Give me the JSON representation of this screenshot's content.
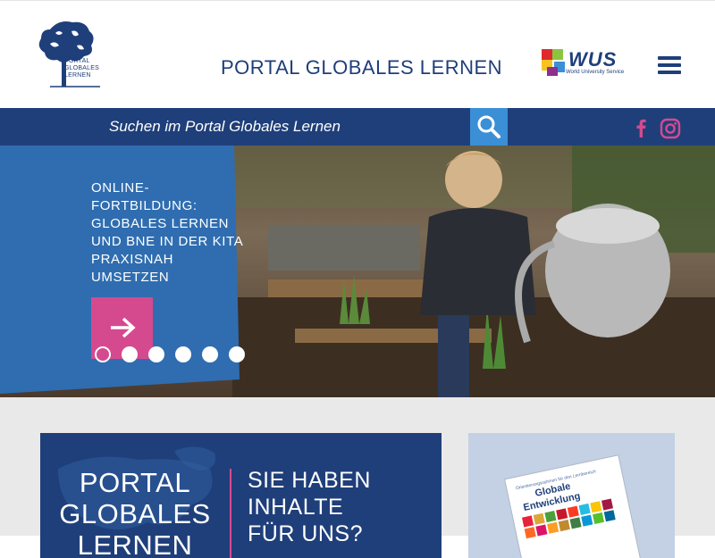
{
  "header": {
    "logo_line1": "PORTAL",
    "logo_line2": "GLOBALES",
    "logo_line3": "LERNEN",
    "site_title": "PORTAL GLOBALES LERNEN",
    "partner_name": "WUS",
    "partner_sub": "World University Service",
    "menu_icon": "hamburger-icon"
  },
  "search": {
    "placeholder": "Suchen im Portal Globales Lernen",
    "button_icon": "search-icon"
  },
  "social": {
    "facebook_icon": "facebook-icon",
    "instagram_icon": "instagram-icon"
  },
  "hero": {
    "title": "Online-Fortbildung: Globales Lernen und BNE in der Kita praxisnah umsetzen",
    "cta_icon": "arrow-right-icon",
    "slide_count": 6,
    "active_slide": 1
  },
  "teasers": {
    "brand_line1": "PORTAL",
    "brand_line2": "GLOBALES",
    "brand_line3": "LERNEN",
    "cta_line1": "SIE HABEN",
    "cta_line2": "INHALTE",
    "cta_line3": "FÜR UNS?",
    "book_subtitle": "Orientierungsrahmen für den Lernbereich",
    "book_title_line1": "Globale",
    "book_title_line2": "Entwicklung"
  },
  "colors": {
    "navy": "#1f3f7a",
    "accent_blue": "#3b8fd6",
    "pink": "#d54a8e",
    "panel_blue": "#2f6db0"
  }
}
